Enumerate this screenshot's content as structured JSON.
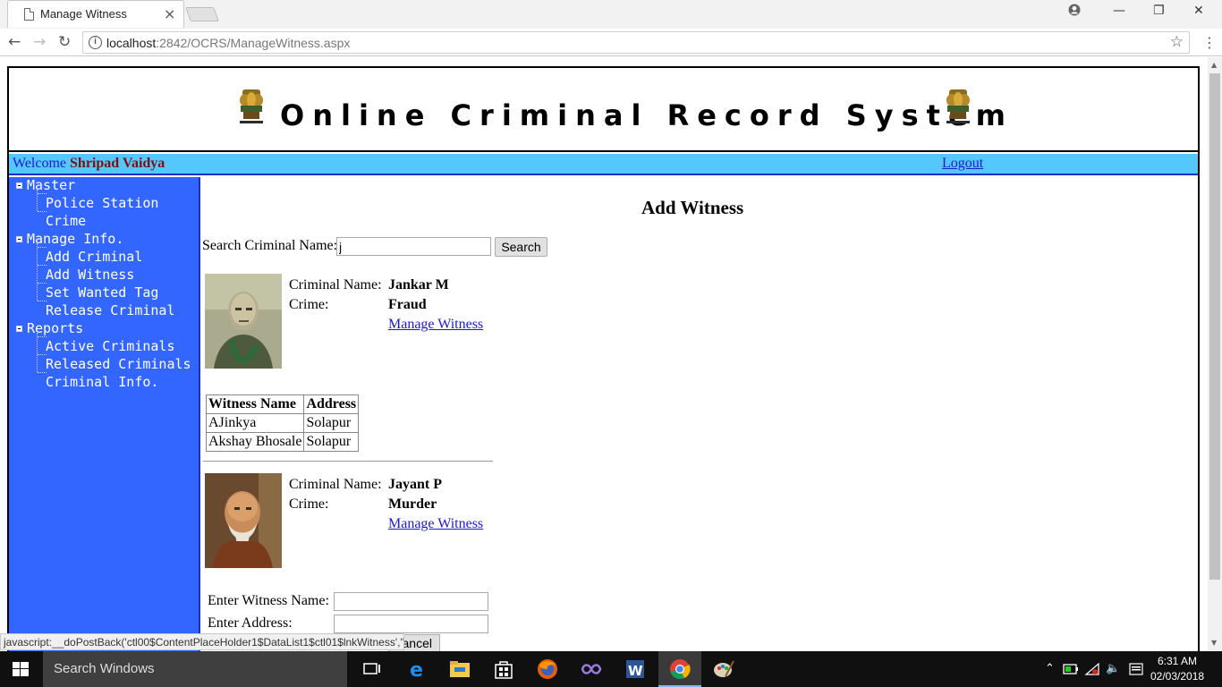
{
  "browser": {
    "tab_title": "Manage Witness",
    "url_host": "localhost",
    "url_rest": ":2842/OCRS/ManageWitness.aspx",
    "status_tip": "javascript:__doPostBack('ctl00$ContentPlaceHolder1$DataList1$ctl01$lnkWitness','')"
  },
  "site": {
    "title": "Online Criminal Record System",
    "welcome_prefix": "Welcome",
    "user_name": "Shripad Vaidya",
    "logout": "Logout"
  },
  "sidebar": {
    "groups": [
      {
        "label": "Master",
        "items": [
          "Police Station",
          "Crime"
        ]
      },
      {
        "label": "Manage Info.",
        "items": [
          "Add Criminal",
          "Add Witness",
          "Set Wanted Tag",
          "Release Criminal"
        ]
      },
      {
        "label": "Reports",
        "items": [
          "Active Criminals",
          "Released Criminals",
          "Criminal Info."
        ]
      }
    ]
  },
  "main": {
    "heading": "Add Witness",
    "search_label": "Search Criminal Name:",
    "search_value": "j",
    "search_button": "Search",
    "name_label": "Criminal Name:",
    "crime_label": "Crime:",
    "manage_link": "Manage Witness",
    "criminals": [
      {
        "name": "Jankar M",
        "crime": "Fraud"
      },
      {
        "name": "Jayant P",
        "crime": "Murder"
      }
    ],
    "witness_table": {
      "headers": [
        "Witness Name",
        "Address"
      ],
      "rows": [
        [
          "AJinkya",
          "Solapur"
        ],
        [
          "Akshay Bhosale",
          "Solapur"
        ]
      ]
    },
    "form": {
      "witness_label": "Enter Witness Name:",
      "address_label": "Enter Address:",
      "cancel_button": "Cancel"
    }
  },
  "taskbar": {
    "search_placeholder": "Search Windows",
    "time": "6:31 AM",
    "date": "02/03/2018"
  }
}
